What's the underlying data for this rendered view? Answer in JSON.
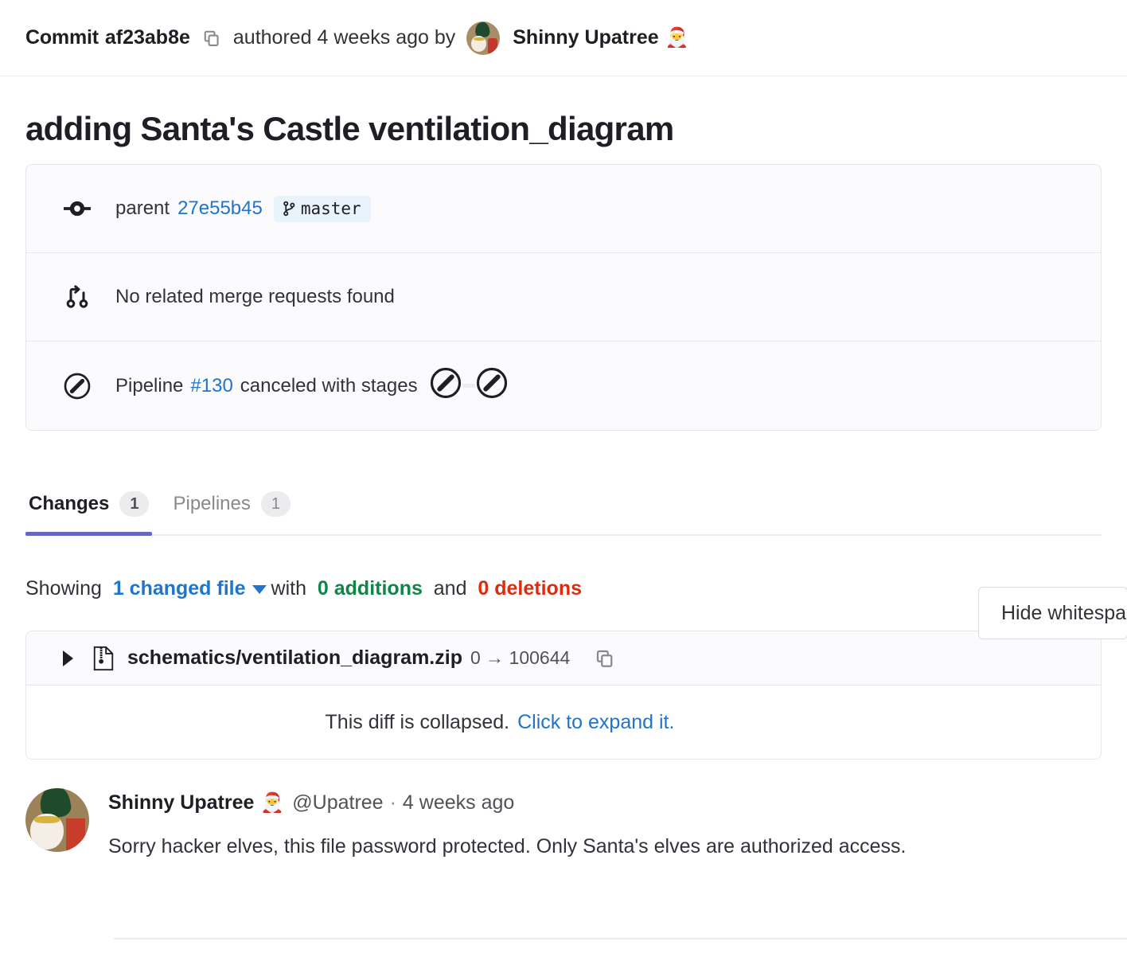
{
  "commit_header": {
    "commit_label": "Commit",
    "sha": "af23ab8e",
    "copy_icon": "copy-icon",
    "authored_text": "authored 4 weeks ago by",
    "author_name": "Shinny Upatree",
    "author_emoji": "🎅"
  },
  "commit_title": "adding Santa's Castle ventilation_diagram",
  "info_box": {
    "parent_row": {
      "icon": "commit-node-icon",
      "label": "parent",
      "parent_sha": "27e55b45",
      "branch_icon": "branch-icon",
      "branch_name": "master"
    },
    "merge_request_row": {
      "icon": "merge-request-icon",
      "text": "No related merge requests found"
    },
    "pipeline_row": {
      "status_icon": "pipeline-canceled-icon",
      "prefix": "Pipeline",
      "pipeline_id": "#130",
      "suffix": "canceled with stages",
      "stages": [
        "canceled",
        "canceled"
      ]
    }
  },
  "tabs": [
    {
      "label": "Changes",
      "count": "1",
      "active": true
    },
    {
      "label": "Pipelines",
      "count": "1",
      "active": false
    }
  ],
  "showing": {
    "prefix": "Showing",
    "files_link": "1 changed file",
    "middle": "with",
    "additions": "0 additions",
    "and": "and",
    "deletions": "0 deletions"
  },
  "whitespace_button": {
    "label": "Hide whitespace changes"
  },
  "diff_file": {
    "toggle_icon": "chevron-right-icon",
    "file_icon": "zip-file-icon",
    "path": "schematics/ventilation_diagram.zip",
    "mode": "0 → 100644",
    "copy_icon": "copy-icon",
    "collapsed_text": "This diff is collapsed.",
    "expand_link": "Click to expand it."
  },
  "note": {
    "author": "Shinny Upatree",
    "author_emoji": "🎅",
    "handle": "@Upatree",
    "separator": "·",
    "timestamp": "4 weeks ago",
    "body": "Sorry hacker elves, this file password protected. Only Santa's elves are authorized access."
  },
  "colors": {
    "link": "#1f75cb",
    "additions": "#108548",
    "deletions": "#dd2b0e",
    "active_tab_underline": "#6666c4",
    "branch_badge_bg": "#e9f3fc"
  }
}
